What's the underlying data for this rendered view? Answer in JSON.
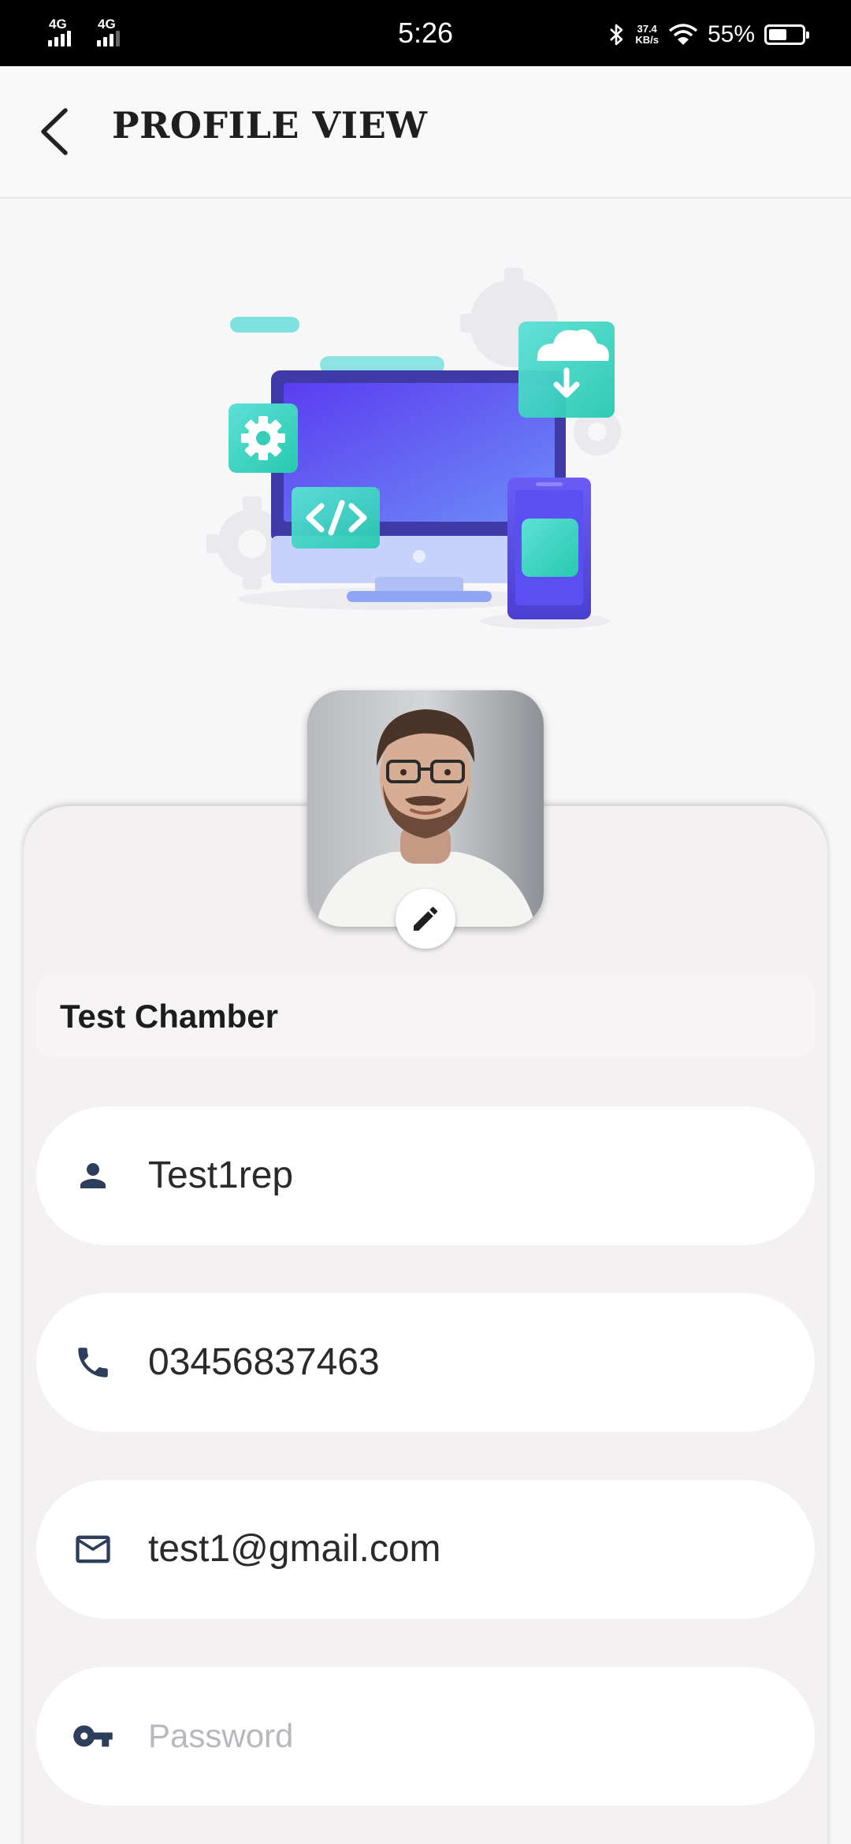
{
  "status_bar": {
    "sim1": "4G",
    "sim2": "4G",
    "time": "5:26",
    "speed_value": "37.4",
    "speed_unit": "KB/s",
    "battery": "55%",
    "battery_level": 0.55
  },
  "app_bar": {
    "back_icon": "arrow-back-icon",
    "title": "PROFILE VIEW"
  },
  "profile": {
    "chamber_name": "Test Chamber",
    "avatar_icon": "avatar-photo",
    "edit_icon": "pencil-icon"
  },
  "fields": {
    "name": {
      "icon": "person-icon",
      "value": "Test1rep"
    },
    "phone": {
      "icon": "phone-icon",
      "value": "03456837463"
    },
    "email": {
      "icon": "mail-icon",
      "value": "test1@gmail.com"
    },
    "password": {
      "icon": "key-icon",
      "placeholder": "Password"
    }
  },
  "colors": {
    "accent_teal": "#2dd4bf",
    "accent_indigo": "#4f46e5",
    "icon_navy": "#2c3e5c"
  }
}
